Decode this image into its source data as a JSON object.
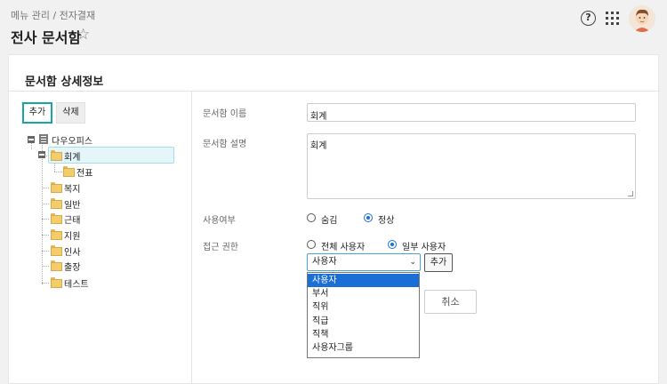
{
  "header": {
    "breadcrumb": "메뉴 관리 / 전자결재",
    "title": "전사 문서함",
    "favorite_icon": "star-outline-icon",
    "help_icon": "question-circle-icon",
    "apps_icon": "grid-apps-icon",
    "avatar_icon": "user-avatar"
  },
  "panel": {
    "title": "문서함 상세정보"
  },
  "tree_toolbar": {
    "add_label": "추가",
    "delete_label": "삭제"
  },
  "tree": {
    "root": "다우오피스",
    "items": [
      "회계",
      "전표",
      "복지",
      "일반",
      "근태",
      "지원",
      "인사",
      "출장",
      "테스트"
    ],
    "selected": "회계"
  },
  "form": {
    "name_label": "문서함 이름",
    "name_value": "회계",
    "desc_label": "문서함 설명",
    "desc_value": "회계",
    "usage_label": "사용여부",
    "usage_options": [
      "숨김",
      "정상"
    ],
    "usage_selected": "정상",
    "access_label": "접근 권한",
    "access_options": [
      "전체 사용자",
      "일부 사용자"
    ],
    "access_selected": "일부 사용자",
    "select_value": "사용자",
    "select_add_label": "추가",
    "dropdown_options": [
      "사용자",
      "부서",
      "직위",
      "직급",
      "직책",
      "사용자그룹"
    ],
    "cancel_label": "취소"
  },
  "colors": {
    "accent": "#1ba4a6",
    "selected_blue": "#1b6ed6",
    "tree_highlight": "#e5f6fa"
  }
}
